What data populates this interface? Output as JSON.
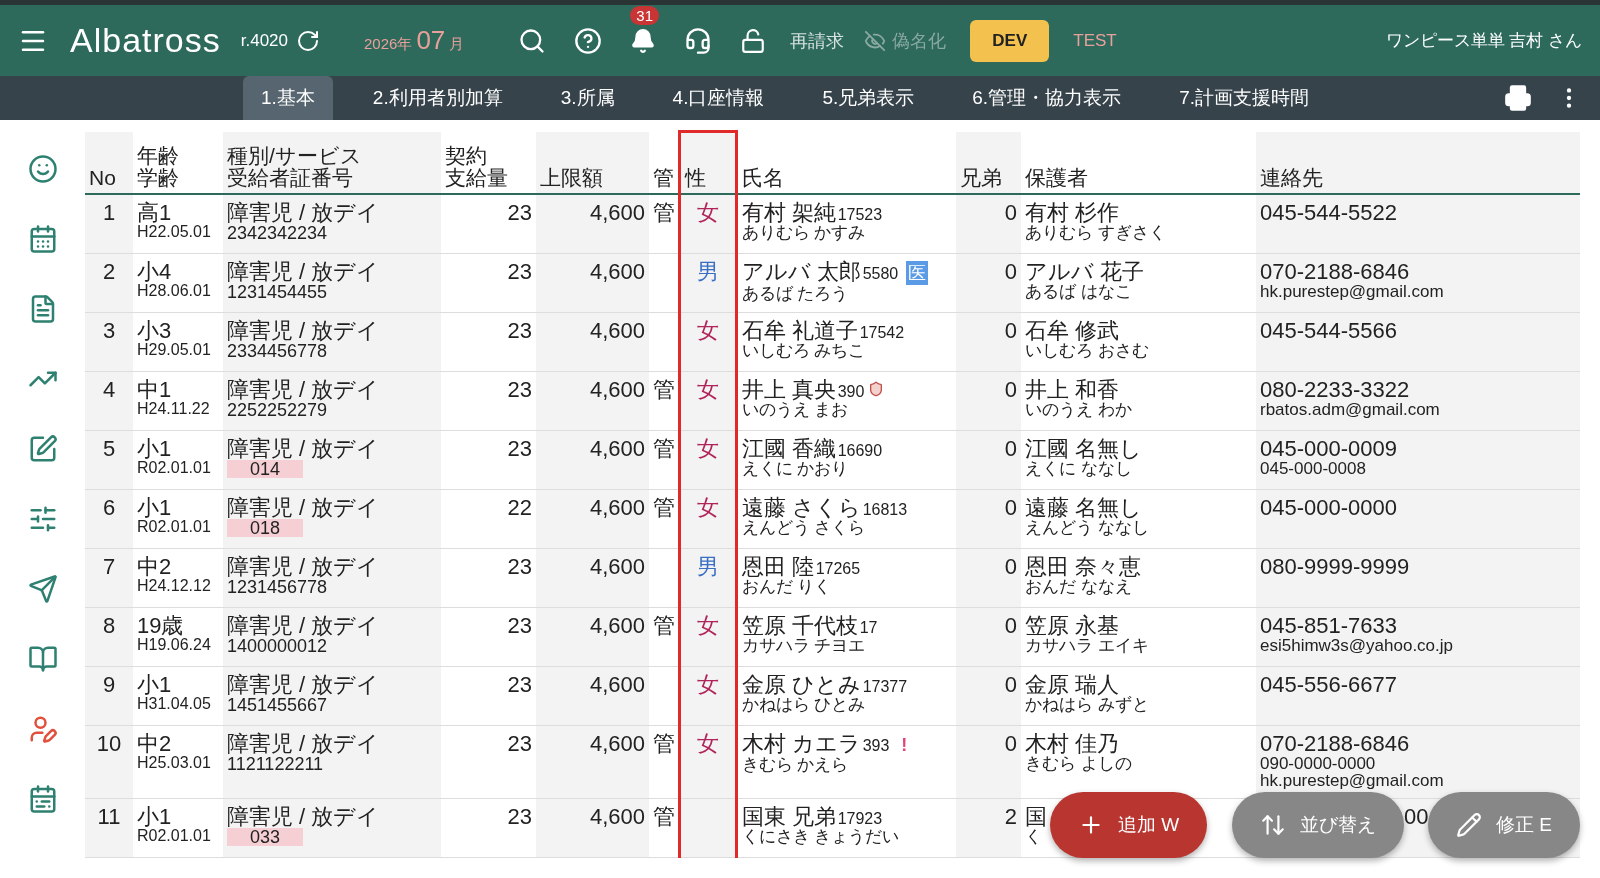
{
  "header": {
    "app_name": "Albatross",
    "revision": "r.4020",
    "year": "2026年",
    "month": "07",
    "month_unit": "月",
    "notification_count": "31",
    "rebill": "再請求",
    "pseudonym": {
      "label": "偽名化",
      "disabled": true
    },
    "env_buttons": [
      {
        "label": "DEV",
        "selected": true
      },
      {
        "label": "TEST",
        "selected": false
      }
    ],
    "user": "ワンピース単単 吉村 さん"
  },
  "tabs": [
    {
      "label": "1.基本",
      "selected": true
    },
    {
      "label": "2.利用者別加算",
      "selected": false
    },
    {
      "label": "3.所属",
      "selected": false
    },
    {
      "label": "4.口座情報",
      "selected": false
    },
    {
      "label": "5.兄弟表示",
      "selected": false
    },
    {
      "label": "6.管理・協力表示",
      "selected": false
    },
    {
      "label": "7.計画支援時間",
      "selected": false
    }
  ],
  "sidebar": {
    "items": [
      {
        "selected": false
      },
      {
        "selected": false
      },
      {
        "selected": false
      },
      {
        "selected": false
      },
      {
        "selected": false
      },
      {
        "selected": false
      },
      {
        "selected": false
      },
      {
        "selected": false
      },
      {
        "selected": true
      },
      {
        "selected": false
      }
    ]
  },
  "table": {
    "columns": [
      {
        "label": "No",
        "highlighted": false
      },
      {
        "label": [
          "年齢",
          "学齢"
        ],
        "highlighted": false
      },
      {
        "label": [
          "種別/サービス",
          "受給者証番号"
        ],
        "highlighted": false
      },
      {
        "label": [
          "契約",
          "支給量"
        ],
        "highlighted": false
      },
      {
        "label": "上限額",
        "highlighted": false
      },
      {
        "label": "管",
        "highlighted": false
      },
      {
        "label": "性",
        "highlighted": true
      },
      {
        "label": "氏名",
        "highlighted": false
      },
      {
        "label": "兄弟",
        "highlighted": false
      },
      {
        "label": "保護者",
        "highlighted": false
      },
      {
        "label": "連絡先",
        "highlighted": false
      }
    ],
    "rows": [
      {
        "no": "1",
        "grade": "高1",
        "birth": "H22.05.01",
        "service": "障害児 / 放デイ",
        "cert": "2342342234",
        "cert_flag": false,
        "amount": "23",
        "limit": "4,600",
        "kan": "管",
        "sex": "女",
        "color": "#b0245a",
        "name": "有村 架純",
        "uid": "17523",
        "kana": "ありむら かすみ",
        "siblings": "0",
        "guardian": "有村 杉作",
        "guardian_kana": "ありむら すぎさく",
        "contacts": [
          "045-544-5522"
        ]
      },
      {
        "no": "2",
        "grade": "小4",
        "birth": "H28.06.01",
        "service": "障害児 / 放デイ",
        "cert": "1231454455",
        "cert_flag": false,
        "amount": "23",
        "limit": "4,600",
        "sex": "男",
        "color": "#3a6fc4",
        "name": "アルバ 太郎",
        "uid": "5580",
        "mark": {
          "kind": "badge",
          "text": "医"
        },
        "kana": "あるば たろう",
        "siblings": "0",
        "guardian": "アルバ 花子",
        "guardian_kana": "あるば はなこ",
        "contacts": [
          "070-2188-6846",
          "hk.purestep@gmail.com"
        ]
      },
      {
        "no": "3",
        "grade": "小3",
        "birth": "H29.05.01",
        "service": "障害児 / 放デイ",
        "cert": "2334456778",
        "cert_flag": false,
        "amount": "23",
        "limit": "4,600",
        "sex": "女",
        "color": "#b0245a",
        "name": "石牟 礼道子",
        "uid": "17542",
        "kana": "いしむろ みちこ",
        "siblings": "0",
        "guardian": "石牟 修武",
        "guardian_kana": "いしむろ おさむ",
        "contacts": [
          "045-544-5566"
        ]
      },
      {
        "no": "4",
        "grade": "中1",
        "birth": "H24.11.22",
        "service": "障害児 / 放デイ",
        "cert": "2252252279",
        "cert_flag": false,
        "amount": "23",
        "limit": "4,600",
        "kan": "管",
        "sex": "女",
        "color": "#b0245a",
        "name": "井上 真央",
        "uid": "390",
        "mark": {
          "kind": "shield"
        },
        "kana": "いのうえ まお",
        "siblings": "0",
        "guardian": "井上 和香",
        "guardian_kana": "いのうえ わか",
        "contacts": [
          "080-2233-3322",
          "rbatos.adm@gmail.com"
        ]
      },
      {
        "no": "5",
        "grade": "小1",
        "birth": "R02.01.01",
        "service": "障害児 / 放デイ",
        "cert": "014",
        "cert_flag": true,
        "amount": "23",
        "limit": "4,600",
        "kan": "管",
        "sex": "女",
        "color": "#b0245a",
        "name": "江國 香織",
        "uid": "16690",
        "kana": "えくに かおり",
        "siblings": "0",
        "guardian": "江國 名無し",
        "guardian_kana": "えくに ななし",
        "contacts": [
          "045-000-0009",
          "045-000-0008"
        ]
      },
      {
        "no": "6",
        "grade": "小1",
        "birth": "R02.01.01",
        "service": "障害児 / 放デイ",
        "cert": "018",
        "cert_flag": true,
        "amount": "22",
        "limit": "4,600",
        "kan": "管",
        "sex": "女",
        "color": "#b0245a",
        "name": "遠藤 さくら",
        "uid": "16813",
        "kana": "えんどう さくら",
        "siblings": "0",
        "guardian": "遠藤 名無し",
        "guardian_kana": "えんどう ななし",
        "contacts": [
          "045-000-0000"
        ]
      },
      {
        "no": "7",
        "grade": "中2",
        "birth": "H24.12.12",
        "service": "障害児 / 放デイ",
        "cert": "1231456778",
        "cert_flag": false,
        "amount": "23",
        "limit": "4,600",
        "sex": "男",
        "color": "#3a6fc4",
        "name": "恩田 陸",
        "uid": "17265",
        "kana": "おんだ りく",
        "siblings": "0",
        "guardian": "恩田 奈々恵",
        "guardian_kana": "おんだ ななえ",
        "contacts": [
          "080-9999-9999"
        ]
      },
      {
        "no": "8",
        "grade": "19歳",
        "birth": "H19.06.24",
        "service": "障害児 / 放デイ",
        "cert": "1400000012",
        "cert_flag": false,
        "amount": "23",
        "limit": "4,600",
        "kan": "管",
        "sex": "女",
        "color": "#b0245a",
        "name": "笠原 千代枝",
        "uid": "17",
        "kana": "カサハラ チヨエ",
        "siblings": "0",
        "guardian": "笠原 永基",
        "guardian_kana": "カサハラ エイキ",
        "contacts": [
          "045-851-7633",
          "esi5himw3s@yahoo.co.jp"
        ]
      },
      {
        "no": "9",
        "grade": "小1",
        "birth": "H31.04.05",
        "service": "障害児 / 放デイ",
        "cert": "1451455667",
        "cert_flag": false,
        "amount": "23",
        "limit": "4,600",
        "sex": "女",
        "color": "#b0245a",
        "name": "金原 ひとみ",
        "uid": "17377",
        "kana": "かねはら ひとみ",
        "siblings": "0",
        "guardian": "金原 瑞人",
        "guardian_kana": "かねはら みずと",
        "contacts": [
          "045-556-6677"
        ]
      },
      {
        "no": "10",
        "grade": "中2",
        "birth": "H25.03.01",
        "service": "障害児 / 放デイ",
        "cert": "1121122211",
        "cert_flag": false,
        "amount": "23",
        "limit": "4,600",
        "kan": "管",
        "sex": "女",
        "color": "#b0245a",
        "name": "木村 カエラ",
        "uid": "393",
        "mark": {
          "kind": "alert",
          "text": "!"
        },
        "kana": "きむら かえら",
        "siblings": "0",
        "guardian": "木村 佳乃",
        "guardian_kana": "きむら よしの",
        "contacts": [
          "070-2188-6846",
          "090-0000-0000",
          "hk.purestep@gmail.com"
        ]
      },
      {
        "no": "11",
        "grade": "小1",
        "birth": "R02.01.01",
        "service": "障害児 / 放デイ",
        "cert": "033",
        "cert_flag": true,
        "amount": "23",
        "limit": "4,600",
        "kan": "管",
        "name": "国東 兄弟",
        "uid": "17923",
        "kana": "くにさき きょうだい",
        "siblings": "2",
        "guardian": "国",
        "guardian_kana": "く",
        "contacts": [
          "00"
        ],
        "covered": true
      }
    ]
  },
  "actions": [
    {
      "label": "追加 W",
      "kind": "add"
    },
    {
      "label": "並び替え",
      "kind": "sort"
    },
    {
      "label": "修正 E",
      "kind": "edit"
    }
  ]
}
